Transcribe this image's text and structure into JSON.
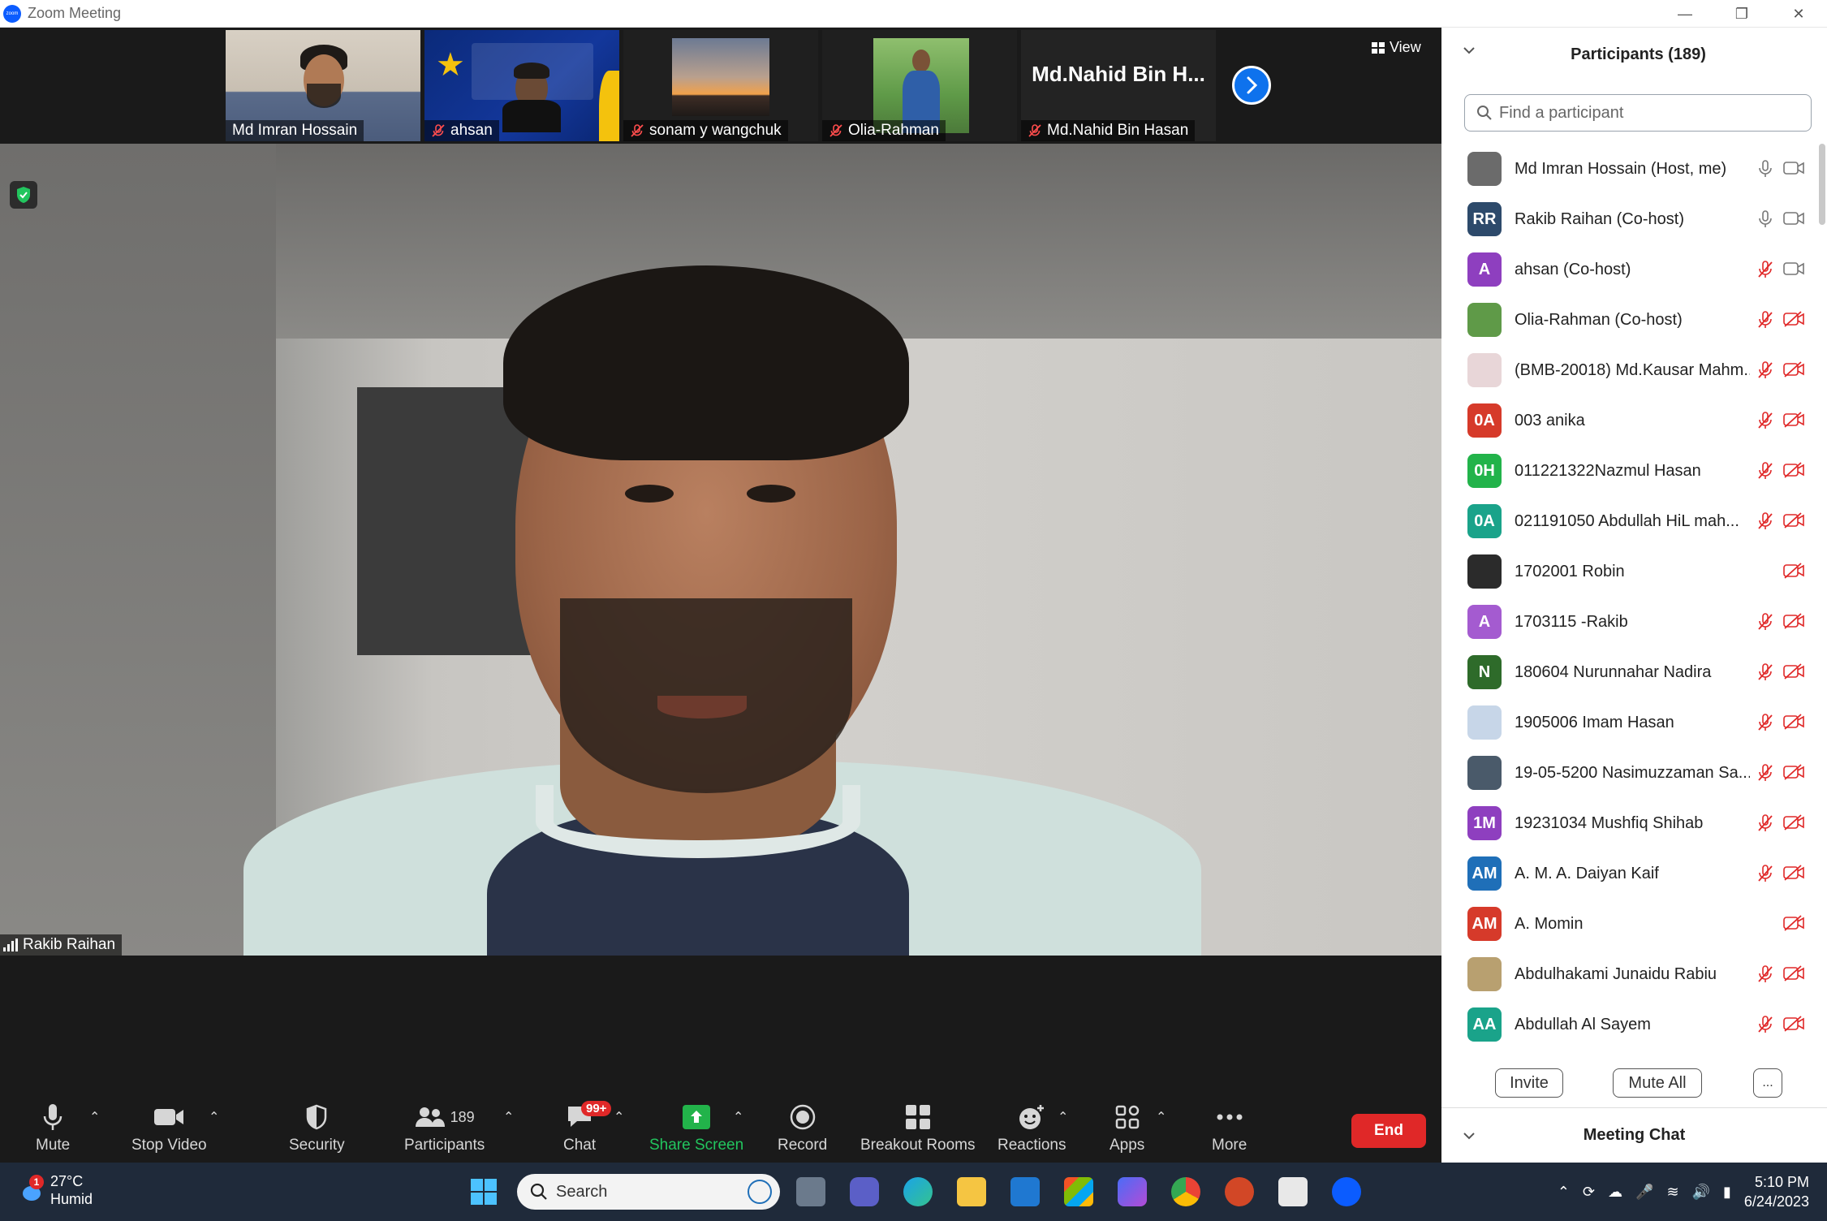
{
  "window": {
    "title": "Zoom Meeting"
  },
  "gallery": {
    "tiles": [
      {
        "name": "Md Imran Hossain",
        "muted": false
      },
      {
        "name": "ahsan",
        "muted": true
      },
      {
        "name": "sonam y wangchuk",
        "muted": true
      },
      {
        "name": "Olia-Rahman",
        "muted": true
      },
      {
        "name": "Md.Nahid Bin Hasan",
        "muted": true,
        "display_name": "Md.Nahid Bin H..."
      }
    ],
    "view_label": "View"
  },
  "main_video": {
    "speaker_name": "Rakib Raihan"
  },
  "toolbar": {
    "mute": "Mute",
    "stop_video": "Stop Video",
    "security": "Security",
    "participants": "Participants",
    "participants_count": "189",
    "chat": "Chat",
    "chat_badge": "99+",
    "share_screen": "Share Screen",
    "record": "Record",
    "breakout_rooms": "Breakout Rooms",
    "reactions": "Reactions",
    "apps": "Apps",
    "more": "More",
    "end": "End"
  },
  "sidebar": {
    "title": "Participants (189)",
    "search_placeholder": "Find a participant",
    "participants": [
      {
        "name": "Md Imran Hossain (Host, me)",
        "initials": "",
        "color": "#6b6b6b",
        "photo": true,
        "mic": "on",
        "cam": "on"
      },
      {
        "name": "Rakib Raihan (Co-host)",
        "initials": "RR",
        "color": "#2d4a6b",
        "photo": false,
        "mic": "on",
        "cam": "on"
      },
      {
        "name": "ahsan (Co-host)",
        "initials": "A",
        "color": "#8e3fbf",
        "photo": false,
        "mic": "off",
        "cam": "on"
      },
      {
        "name": "Olia-Rahman (Co-host)",
        "initials": "",
        "color": "#5f9a48",
        "photo": true,
        "mic": "off",
        "cam": "off"
      },
      {
        "name": "(BMB-20018) Md.Kausar Mahm...",
        "initials": "",
        "color": "#e8d6d8",
        "photo": true,
        "mic": "off",
        "cam": "off"
      },
      {
        "name": "003 anika",
        "initials": "0A",
        "color": "#d63a2a",
        "photo": false,
        "mic": "off",
        "cam": "off"
      },
      {
        "name": "011221322Nazmul Hasan",
        "initials": "0H",
        "color": "#22b34a",
        "photo": false,
        "mic": "off",
        "cam": "off"
      },
      {
        "name": "021191050 Abdullah HiL mah...",
        "initials": "0A",
        "color": "#1aa38a",
        "photo": false,
        "mic": "off",
        "cam": "off"
      },
      {
        "name": "1702001 Robin",
        "initials": "",
        "color": "#2b2b2b",
        "photo": true,
        "mic": "none",
        "cam": "off"
      },
      {
        "name": "1703115 -Rakib",
        "initials": "A",
        "color": "#a45bd0",
        "photo": false,
        "mic": "off",
        "cam": "off"
      },
      {
        "name": "180604 Nurunnahar Nadira",
        "initials": "N",
        "color": "#2e6b2a",
        "photo": false,
        "mic": "off",
        "cam": "off"
      },
      {
        "name": "1905006 Imam Hasan",
        "initials": "",
        "color": "#c7d6e8",
        "photo": true,
        "mic": "off",
        "cam": "off"
      },
      {
        "name": "19-05-5200 Nasimuzzaman Sa...",
        "initials": "",
        "color": "#4a5a6a",
        "photo": true,
        "mic": "off",
        "cam": "off"
      },
      {
        "name": "19231034 Mushfiq Shihab",
        "initials": "1M",
        "color": "#8e3fbf",
        "photo": false,
        "mic": "off",
        "cam": "off"
      },
      {
        "name": "A. M. A. Daiyan Kaif",
        "initials": "AM",
        "color": "#1f6fb8",
        "photo": false,
        "mic": "off",
        "cam": "off"
      },
      {
        "name": "A. Momin",
        "initials": "AM",
        "color": "#d63a2a",
        "photo": false,
        "mic": "none",
        "cam": "off"
      },
      {
        "name": "Abdulhakami Junaidu Rabiu",
        "initials": "",
        "color": "#b8a070",
        "photo": true,
        "mic": "off",
        "cam": "off"
      },
      {
        "name": "Abdullah Al Sayem",
        "initials": "AA",
        "color": "#1aa38a",
        "photo": false,
        "mic": "off",
        "cam": "off"
      }
    ],
    "invite": "Invite",
    "mute_all": "Mute All",
    "more": "...",
    "chat_title": "Meeting Chat"
  },
  "taskbar": {
    "weather_temp": "27°C",
    "weather_desc": "Humid",
    "weather_badge": "1",
    "search_label": "Search",
    "time": "5:10 PM",
    "date": "6/24/2023"
  }
}
